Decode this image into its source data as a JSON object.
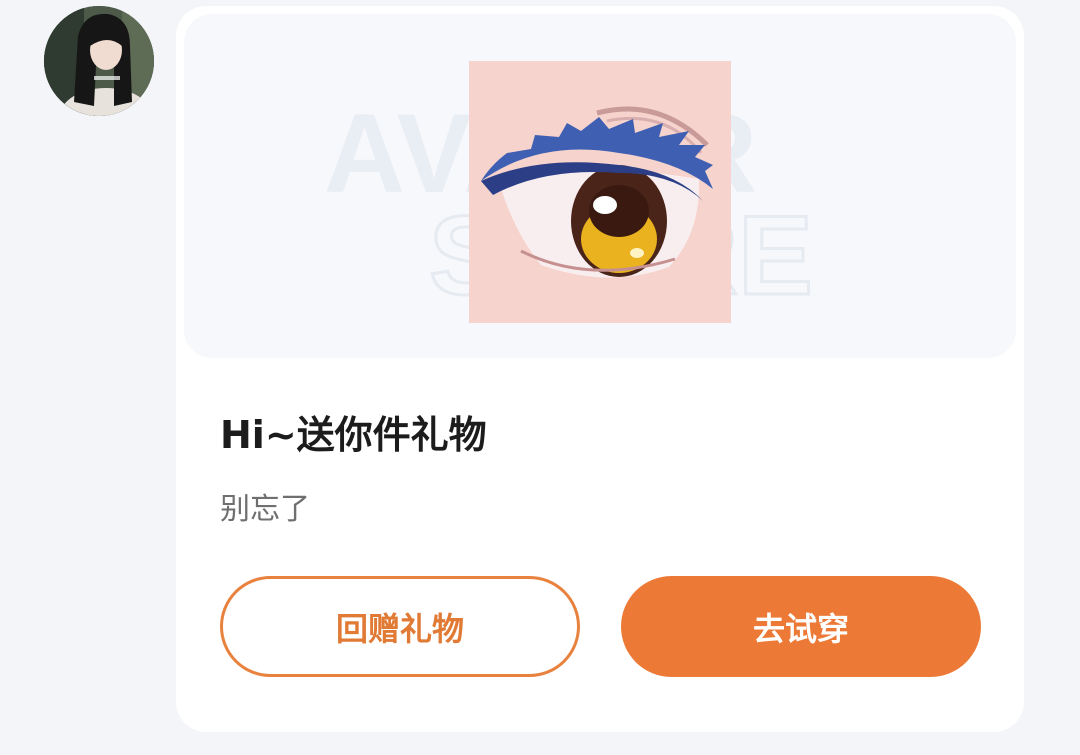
{
  "message": {
    "sender_avatar": "user-avatar-photo",
    "watermark": [
      "AVATAR",
      "STORE"
    ],
    "item_image": "anime-eye-makeup-item",
    "title": "Hi~送你件礼物",
    "subtitle": "别忘了",
    "buttons": {
      "return_gift": "回赠礼物",
      "try_on": "去试穿"
    },
    "colors": {
      "accent": "#ec7a36",
      "background": "#f3f5f9",
      "card": "#ffffff"
    }
  }
}
